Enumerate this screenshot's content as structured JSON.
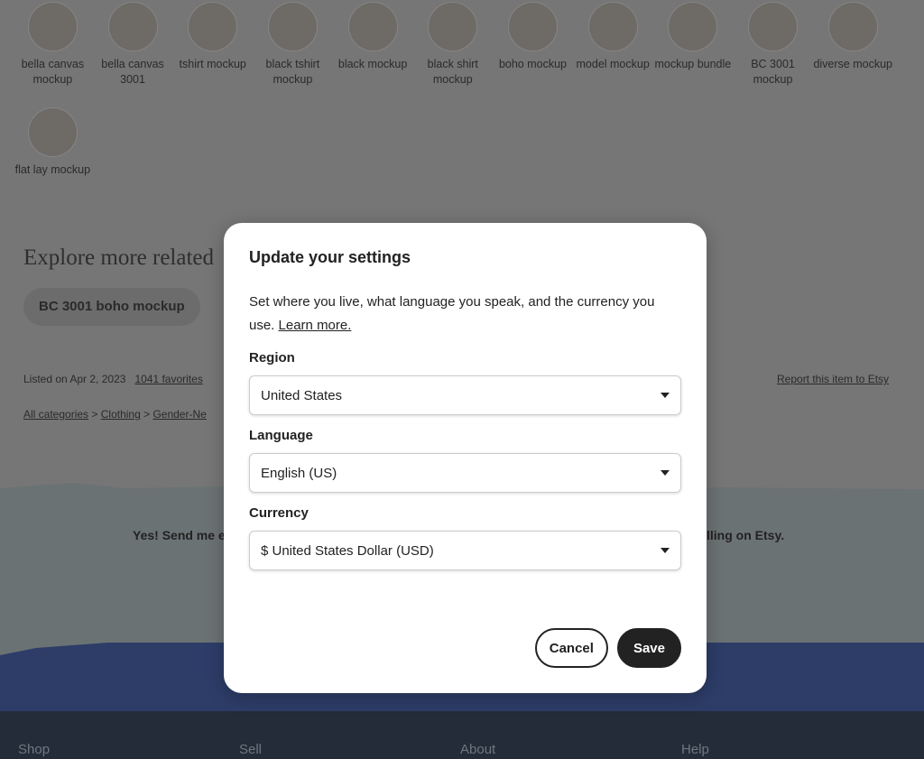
{
  "related_searches": [
    {
      "label": "bella canvas mockup"
    },
    {
      "label": "bella canvas 3001"
    },
    {
      "label": "tshirt mockup"
    },
    {
      "label": "black tshirt mockup"
    },
    {
      "label": "black mockup"
    },
    {
      "label": "black shirt mockup"
    },
    {
      "label": "boho mockup"
    },
    {
      "label": "model mockup"
    },
    {
      "label": "mockup bundle"
    },
    {
      "label": "BC 3001 mockup"
    },
    {
      "label": "diverse mockup"
    },
    {
      "label": "flat lay mockup"
    }
  ],
  "explore": {
    "title": "Explore more related",
    "pill": "BC 3001 boho mockup"
  },
  "meta": {
    "listed": "Listed on Apr 2, 2023",
    "favorites": "1041 favorites",
    "report": "Report this item to Etsy"
  },
  "breadcrumb": [
    "All categories",
    "Clothing",
    "Gender-Ne"
  ],
  "newsletter": {
    "left": "Yes! Send me e",
    "right": "lling on Etsy."
  },
  "footer": [
    "Shop",
    "Sell",
    "About",
    "Help"
  ],
  "modal": {
    "title": "Update your settings",
    "description": "Set where you live, what language you speak, and the currency you use.",
    "learn_more": "Learn more.",
    "region_label": "Region",
    "region_value": "United States",
    "language_label": "Language",
    "language_value": "English (US)",
    "currency_label": "Currency",
    "currency_value": "$ United States Dollar (USD)",
    "cancel": "Cancel",
    "save": "Save"
  }
}
